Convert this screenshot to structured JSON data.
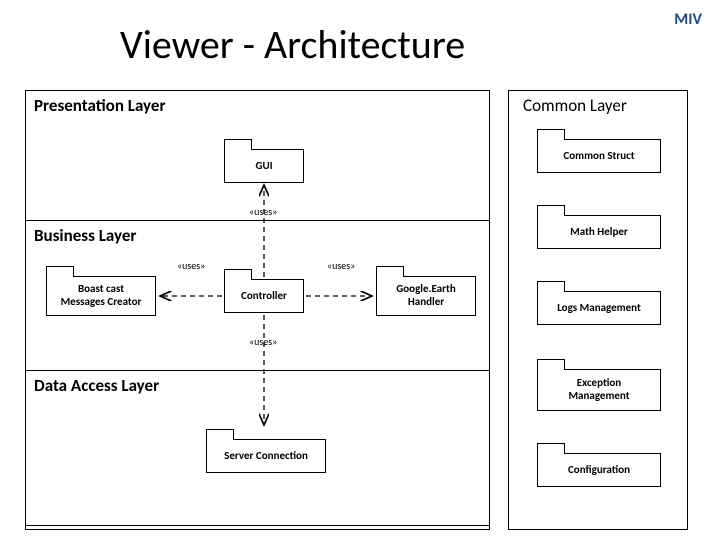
{
  "brand": "MIV",
  "title": "Viewer - Architecture",
  "layers": {
    "presentation": "Presentation Layer",
    "business": "Business Layer",
    "data": "Data Access Layer",
    "common": "Common Layer"
  },
  "packages": {
    "gui": "GUI",
    "broadcast": "Boast cast\nMessages Creator",
    "controller": "Controller",
    "ge_handler": "Google.Earth\nHandler",
    "server_conn": "Server Connection",
    "common_struct": "Common Struct",
    "math_helper": "Math Helper",
    "logs_mgmt": "Logs Management",
    "exception_mgmt": "Exception\nManagement",
    "configuration": "Configuration"
  },
  "relations": {
    "uses": "«uses»"
  }
}
